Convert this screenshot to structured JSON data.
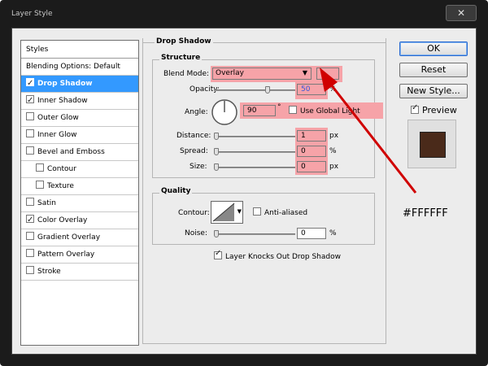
{
  "window": {
    "title": "Layer Style",
    "close_glyph": "✕"
  },
  "styles_panel": {
    "header": "Styles",
    "items": [
      {
        "label": "Blending Options: Default",
        "checkbox": false
      },
      {
        "label": "Drop Shadow",
        "checkbox": true,
        "checked": true,
        "selected": true
      },
      {
        "label": "Inner Shadow",
        "checkbox": true,
        "checked": true
      },
      {
        "label": "Outer Glow",
        "checkbox": true,
        "checked": false
      },
      {
        "label": "Inner Glow",
        "checkbox": true,
        "checked": false
      },
      {
        "label": "Bevel and Emboss",
        "checkbox": true,
        "checked": false
      },
      {
        "label": "Contour",
        "checkbox": true,
        "checked": false,
        "indent": true
      },
      {
        "label": "Texture",
        "checkbox": true,
        "checked": false,
        "indent": true
      },
      {
        "label": "Satin",
        "checkbox": true,
        "checked": false
      },
      {
        "label": "Color Overlay",
        "checkbox": true,
        "checked": true
      },
      {
        "label": "Gradient Overlay",
        "checkbox": true,
        "checked": false
      },
      {
        "label": "Pattern Overlay",
        "checkbox": true,
        "checked": false
      },
      {
        "label": "Stroke",
        "checkbox": true,
        "checked": false
      }
    ]
  },
  "drop_shadow": {
    "title": "Drop Shadow",
    "structure": {
      "title": "Structure",
      "blend_mode_label": "Blend Mode:",
      "blend_mode_value": "Overlay",
      "opacity_label": "Opacity:",
      "opacity_value": "50",
      "opacity_unit": "%",
      "opacity_fraction": 0.5,
      "angle_label": "Angle:",
      "angle_value": "90",
      "angle_unit": "°",
      "use_global_light_label": "Use Global Light",
      "use_global_light_checked": false,
      "distance_label": "Distance:",
      "distance_value": "1",
      "distance_unit": "px",
      "spread_label": "Spread:",
      "spread_value": "0",
      "spread_unit": "%",
      "size_label": "Size:",
      "size_value": "0",
      "size_unit": "px"
    },
    "quality": {
      "title": "Quality",
      "contour_label": "Contour:",
      "anti_aliased_label": "Anti-aliased",
      "anti_aliased_checked": false,
      "noise_label": "Noise:",
      "noise_value": "0",
      "noise_unit": "%"
    },
    "knockout_label": "Layer Knocks Out Drop Shadow",
    "knockout_checked": true
  },
  "buttons": {
    "ok": "OK",
    "reset": "Reset",
    "new_style": "New Style...",
    "preview_label": "Preview",
    "preview_checked": true
  },
  "annotation": {
    "text": "#FFFFFF",
    "arrow_color": "#d00000"
  },
  "colors": {
    "highlight": "#f6a3a8",
    "selection": "#3399ff",
    "preview_swatch": "#4a2a1a"
  }
}
